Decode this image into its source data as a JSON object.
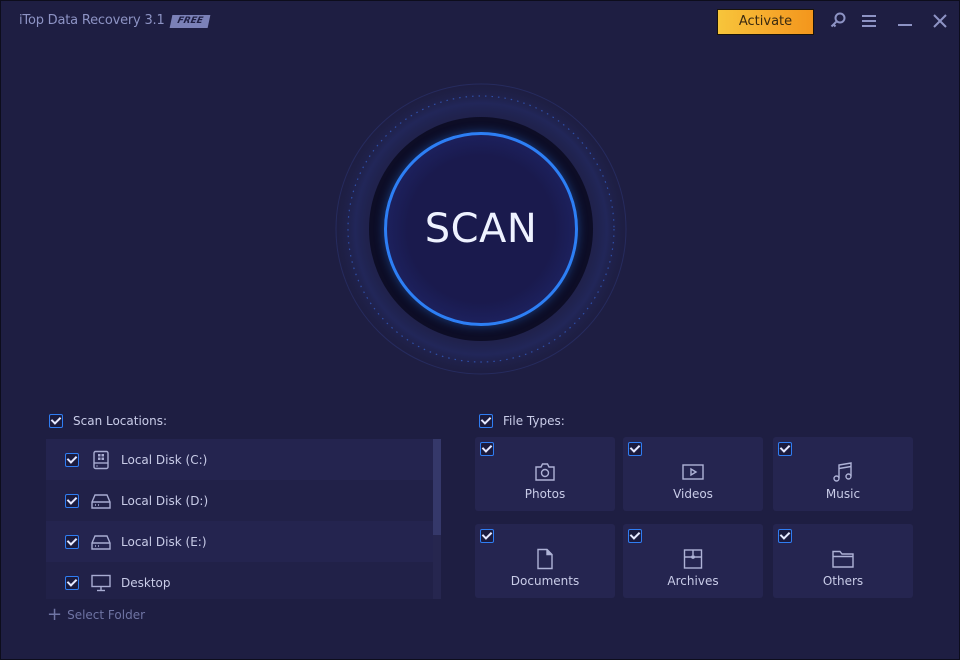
{
  "titlebar": {
    "app_title": "iTop Data Recovery 3.1",
    "badge": "FREE",
    "activate_label": "Activate",
    "icons": [
      "key-icon",
      "menu-icon",
      "minimize-icon",
      "close-icon"
    ]
  },
  "scan": {
    "label": "SCAN",
    "accent_color": "#2d7ff5"
  },
  "scan_locations": {
    "header": "Scan Locations:",
    "checked": true,
    "items": [
      {
        "label": "Local Disk (C:)",
        "icon": "windows-drive-icon",
        "checked": true
      },
      {
        "label": "Local Disk (D:)",
        "icon": "drive-icon",
        "checked": true
      },
      {
        "label": "Local Disk (E:)",
        "icon": "drive-icon",
        "checked": true
      },
      {
        "label": "Desktop",
        "icon": "monitor-icon",
        "checked": true
      }
    ],
    "select_folder_label": "Select Folder"
  },
  "file_types": {
    "header": "File Types:",
    "checked": true,
    "items": [
      {
        "label": "Photos",
        "icon": "camera-icon",
        "checked": true
      },
      {
        "label": "Videos",
        "icon": "video-icon",
        "checked": true
      },
      {
        "label": "Music",
        "icon": "music-icon",
        "checked": true
      },
      {
        "label": "Documents",
        "icon": "document-icon",
        "checked": true
      },
      {
        "label": "Archives",
        "icon": "archive-icon",
        "checked": true
      },
      {
        "label": "Others",
        "icon": "folder-icon",
        "checked": true
      }
    ]
  },
  "colors": {
    "background": "#1e1e42",
    "activate_button": "#f6a72a",
    "checkbox_border": "#2f7df3"
  }
}
